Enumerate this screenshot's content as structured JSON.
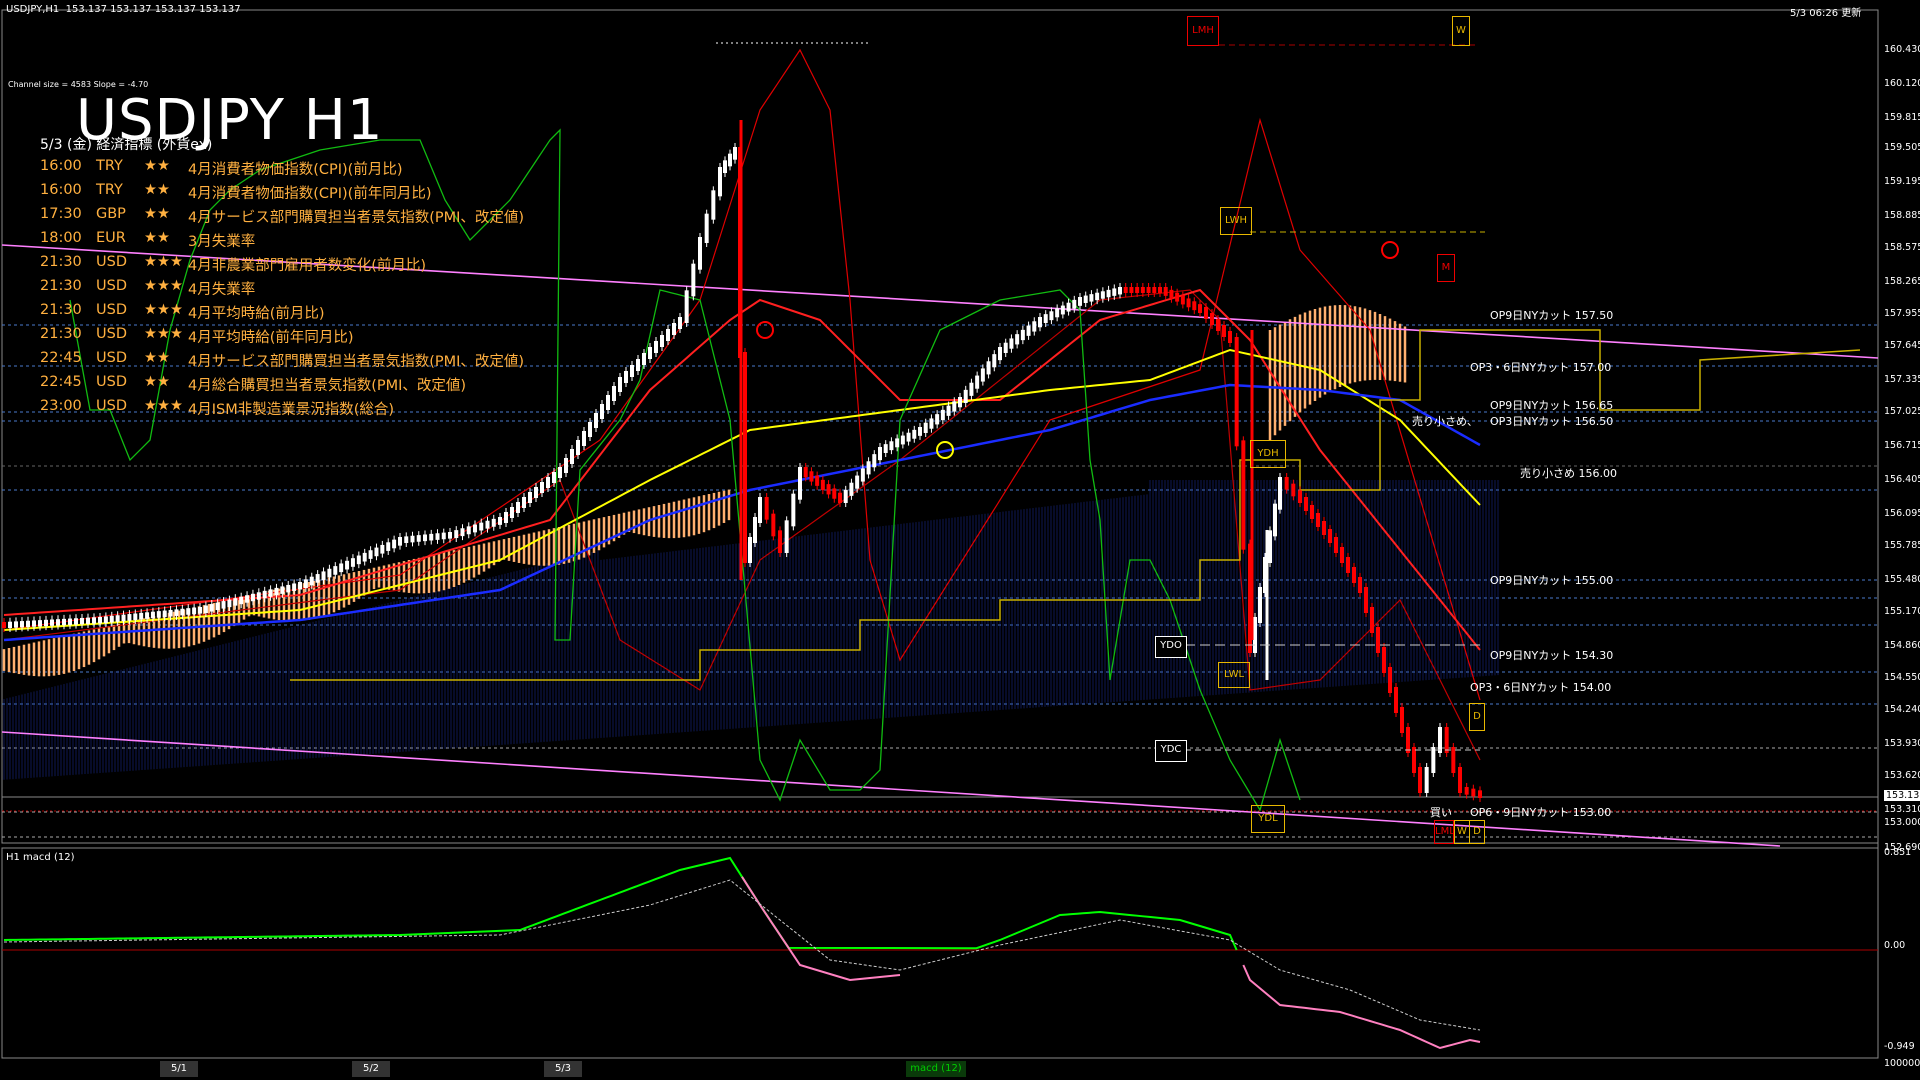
{
  "header": {
    "symbol_info": "USDJPY,H1  153.137 153.137 153.137 153.137",
    "datetime_update": "5/3 06:26 更新",
    "channel_info": "Channel size = 4583 Slope = -4.70"
  },
  "title": "USDJPY H1",
  "economic_calendar": {
    "subtitle": "5/3 (金) 経済指標 (外貨ex)",
    "rows": [
      {
        "time": "16:00",
        "cur": "TRY",
        "stars": "★★",
        "event": "4月消費者物価指数(CPI)(前月比)",
        "color": "#ffb040"
      },
      {
        "time": "16:00",
        "cur": "TRY",
        "stars": "★★",
        "event": "4月消費者物価指数(CPI)(前年同月比)",
        "color": "#ffb040"
      },
      {
        "time": "17:30",
        "cur": "GBP",
        "stars": "★★",
        "event": "4月サービス部門購買担当者景気指数(PMI、改定値)",
        "color": "#ffb040"
      },
      {
        "time": "18:00",
        "cur": "EUR",
        "stars": "★★",
        "event": "3月失業率",
        "color": "#ffb040"
      },
      {
        "time": "21:30",
        "cur": "USD",
        "stars": "★★★",
        "event": "4月非農業部門雇用者数変化(前月比)",
        "color": "#ffb040"
      },
      {
        "time": "21:30",
        "cur": "USD",
        "stars": "★★★",
        "event": "4月失業率",
        "color": "#ffb040"
      },
      {
        "time": "21:30",
        "cur": "USD",
        "stars": "★★★",
        "event": "4月平均時給(前月比)",
        "color": "#ffb040"
      },
      {
        "time": "21:30",
        "cur": "USD",
        "stars": "★★★",
        "event": "4月平均時給(前年同月比)",
        "color": "#ffb040"
      },
      {
        "time": "22:45",
        "cur": "USD",
        "stars": "★★",
        "event": "4月サービス部門購買担当者景気指数(PMI、改定値)",
        "color": "#ffb040"
      },
      {
        "time": "22:45",
        "cur": "USD",
        "stars": "★★",
        "event": "4月総合購買担当者景気指数(PMI、改定値)",
        "color": "#ffb040"
      },
      {
        "time": "23:00",
        "cur": "USD",
        "stars": "★★★",
        "event": "4月ISM非製造業景況指数(総合)",
        "color": "#ffb040"
      }
    ]
  },
  "price_axis": [
    "160.430",
    "160.120",
    "159.815",
    "159.505",
    "159.195",
    "158.885",
    "158.575",
    "158.265",
    "157.955",
    "157.645",
    "157.335",
    "157.025",
    "156.715",
    "156.405",
    "156.095",
    "155.785",
    "155.480",
    "155.170",
    "154.860",
    "154.550",
    "154.240",
    "153.930",
    "153.620",
    "153.310",
    "153.137",
    "153.000",
    "152.690"
  ],
  "macd_axis": [
    "0.851",
    "0.00",
    "-0.949",
    "100000"
  ],
  "macd_label": "H1 macd (12)",
  "option_levels": [
    {
      "label": "OP9日NYカット 157.50"
    },
    {
      "label": "OP3・6日NYカット 157.00"
    },
    {
      "label": "OP9日NYカット 156.65"
    },
    {
      "label": "OP3日NYカット 156.50"
    },
    {
      "label": "売り小さめ、"
    },
    {
      "label": "売り小さめ 156.00"
    },
    {
      "label": "OP9日NYカット 155.00"
    },
    {
      "label": "OP9日NYカット 154.30"
    },
    {
      "label": "OP3・6日NYカット 154.00"
    },
    {
      "label": "買い"
    },
    {
      "label": "OP6・9日NYカット 153.00"
    }
  ],
  "boxes": {
    "lmh": "LMH",
    "w_top": "W",
    "lwh": "LWH",
    "m": "M",
    "ydh": "YDH",
    "ydo": "YDO",
    "lwl": "LWL",
    "ydc": "YDC",
    "d1": "D",
    "ydl": "YDL",
    "lml": "LML",
    "w_bot": "W",
    "d2": "D"
  },
  "time_tabs": [
    "5/1",
    "5/2",
    "5/3"
  ],
  "indicator_tab": "macd (12)",
  "colors": {
    "bg": "#000000",
    "candle_up": "#ffffff",
    "candle_down": "#ff0000",
    "ma_yellow": "#ffff00",
    "ma_blue": "#0000ff",
    "channel": "#ff80ff",
    "kumo": "#ffb070",
    "macd_main": "#00ff00"
  }
}
